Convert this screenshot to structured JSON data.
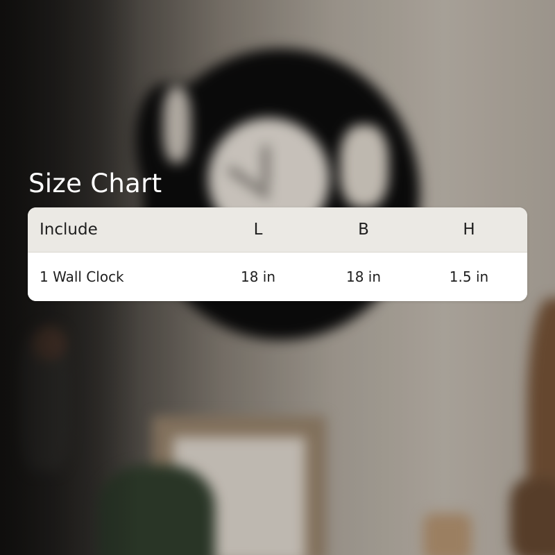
{
  "title": "Size Chart",
  "table": {
    "headers": [
      "Include",
      "L",
      "B",
      "H"
    ],
    "rows": [
      [
        "1 Wall Clock",
        "18 in",
        "18 in",
        "1.5 in"
      ]
    ]
  },
  "colors": {
    "header_bg": "#ebe9e4",
    "row_bg": "#ffffff",
    "text": "#1e1e1e",
    "title_text": "#ffffff"
  }
}
